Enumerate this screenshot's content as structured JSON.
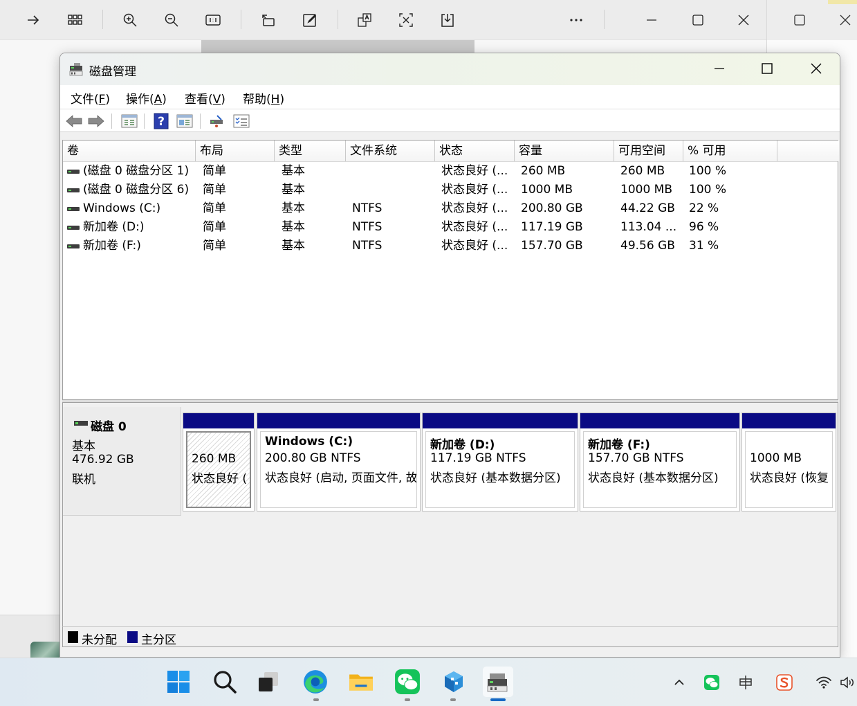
{
  "viewer": {
    "toolbar_icons": [
      "arrow-right-icon",
      "grid-icon",
      "zoom-in-icon",
      "zoom-out-icon",
      "actual-size-icon",
      "rotate-icon",
      "edit-icon",
      "translate-icon",
      "crop-text-icon",
      "save-icon",
      "more-icon",
      "minimize-icon",
      "maximize-icon",
      "close-icon"
    ]
  },
  "window": {
    "title": "磁盘管理",
    "icon": "disk-management-icon"
  },
  "menu": [
    {
      "label": "文件(",
      "key": "F",
      "tail": ")"
    },
    {
      "label": "操作(",
      "key": "A",
      "tail": ")"
    },
    {
      "label": "查看(",
      "key": "V",
      "tail": ")"
    },
    {
      "label": "帮助(",
      "key": "H",
      "tail": ")"
    }
  ],
  "toolbar_icons": [
    "back-icon",
    "forward-icon",
    "list-view-icon",
    "help-icon",
    "properties-icon",
    "connect-icon",
    "checklist-icon"
  ],
  "volume_table": {
    "headers": [
      "卷",
      "布局",
      "类型",
      "文件系统",
      "状态",
      "容量",
      "可用空间",
      "% 可用"
    ],
    "rows": [
      {
        "vol": "(磁盘 0 磁盘分区 1)",
        "layout": "简单",
        "type": "基本",
        "fs": "",
        "status": "状态良好 (...",
        "capacity": "260 MB",
        "free": "260 MB",
        "pct": "100 %"
      },
      {
        "vol": "(磁盘 0 磁盘分区 6)",
        "layout": "简单",
        "type": "基本",
        "fs": "",
        "status": "状态良好 (...",
        "capacity": "1000 MB",
        "free": "1000 MB",
        "pct": "100 %"
      },
      {
        "vol": "Windows (C:)",
        "layout": "简单",
        "type": "基本",
        "fs": "NTFS",
        "status": "状态良好 (...",
        "capacity": "200.80 GB",
        "free": "44.22 GB",
        "pct": "22 %"
      },
      {
        "vol": "新加卷 (D:)",
        "layout": "简单",
        "type": "基本",
        "fs": "NTFS",
        "status": "状态良好 (...",
        "capacity": "117.19 GB",
        "free": "113.04 ...",
        "pct": "96 %"
      },
      {
        "vol": "新加卷 (F:)",
        "layout": "简单",
        "type": "基本",
        "fs": "NTFS",
        "status": "状态良好 (...",
        "capacity": "157.70 GB",
        "free": "49.56 GB",
        "pct": "31 %"
      }
    ]
  },
  "disk": {
    "name": "磁盘 0",
    "kind": "基本",
    "size": "476.92 GB",
    "state": "联机",
    "partitions": [
      {
        "name": "",
        "size": "260 MB",
        "status": "状态良好 ("
      },
      {
        "name": "Windows  (C:)",
        "size": "200.80 GB NTFS",
        "status": "状态良好 (启动, 页面文件, 故"
      },
      {
        "name": "新加卷  (D:)",
        "size": "117.19 GB NTFS",
        "status": "状态良好 (基本数据分区)"
      },
      {
        "name": "新加卷  (F:)",
        "size": "157.70 GB NTFS",
        "status": "状态良好 (基本数据分区)"
      },
      {
        "name": "",
        "size": "1000 MB",
        "status": "状态良好 (恢复"
      }
    ]
  },
  "legend": [
    {
      "label": "未分配",
      "color": "#000000"
    },
    {
      "label": "主分区",
      "color": "#0a0a84"
    }
  ],
  "taskbar": {
    "apps": [
      "windows-start-icon",
      "search-icon",
      "task-view-icon",
      "edge-icon",
      "file-explorer-icon",
      "wechat-icon",
      "app-cube-icon",
      "disk-management-taskbar-icon"
    ],
    "tray": [
      "chevron-up-icon",
      "wechat-tray-icon",
      "ime-icon",
      "sogou-icon",
      "wifi-icon",
      "volume-icon"
    ]
  }
}
